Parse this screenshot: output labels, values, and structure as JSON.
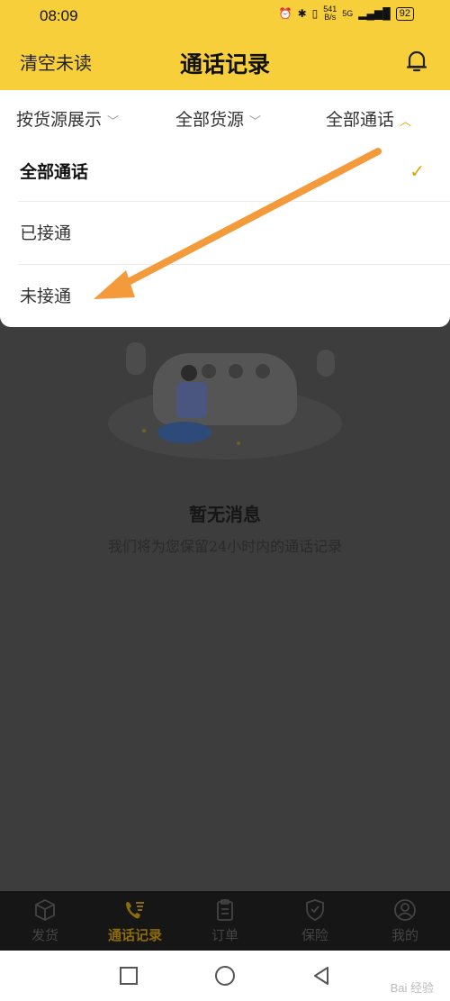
{
  "status_bar": {
    "time": "08:09",
    "net_speed_value": "541",
    "net_speed_unit": "B/s",
    "network": "5G",
    "battery": "92"
  },
  "header": {
    "left_action": "清空未读",
    "title": "通话记录",
    "right_icon": "bell-icon"
  },
  "filters": [
    {
      "label": "按货源展示",
      "icon": "chevron-down-icon"
    },
    {
      "label": "全部货源",
      "icon": "chevron-down-icon"
    },
    {
      "label": "全部通话",
      "icon": "chevron-up-icon"
    }
  ],
  "dropdown": {
    "options": [
      {
        "label": "全部通话",
        "selected": true,
        "icon": "check-icon"
      },
      {
        "label": "已接通",
        "selected": false
      },
      {
        "label": "未接通",
        "selected": false
      }
    ]
  },
  "empty_state": {
    "title": "暂无消息",
    "subtitle": "我们将为您保留24小时内的通话记录"
  },
  "tab_bar": [
    {
      "label": "发货",
      "icon": "box-icon",
      "active": false
    },
    {
      "label": "通话记录",
      "icon": "phone-list-icon",
      "active": true
    },
    {
      "label": "订单",
      "icon": "clipboard-icon",
      "active": false
    },
    {
      "label": "保险",
      "icon": "shield-check-icon",
      "active": false
    },
    {
      "label": "我的",
      "icon": "user-icon",
      "active": false
    }
  ],
  "nav_bar": [
    "square-icon",
    "circle-icon",
    "back-triangle-icon"
  ],
  "watermark": "Bai 经验",
  "colors": {
    "accent_yellow": "#f7cf3a",
    "check_gold": "#e0a400",
    "arrow_orange": "#f39a3a",
    "overlay": "#3d3d3d"
  }
}
